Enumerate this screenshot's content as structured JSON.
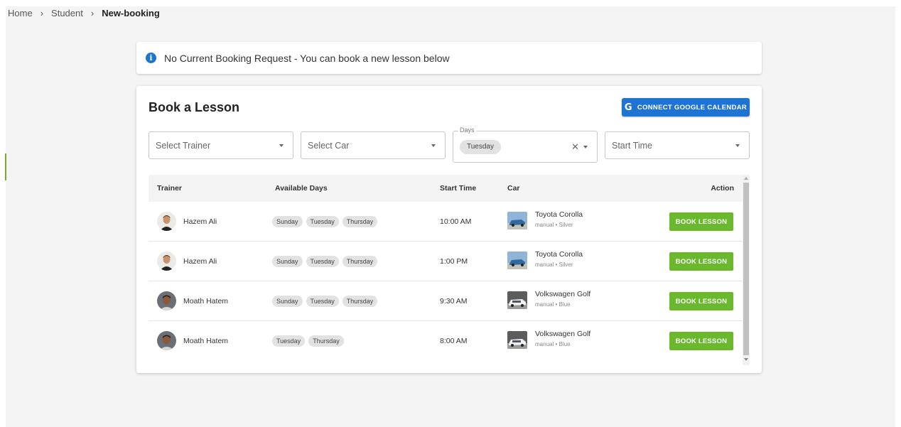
{
  "breadcrumb": {
    "items": [
      "Home",
      "Student",
      "New-booking"
    ],
    "separator": "›"
  },
  "alert": {
    "icon": "info-icon",
    "text": "No Current Booking Request - You can book a new lesson below"
  },
  "booking": {
    "title": "Book a Lesson",
    "gcal_button": {
      "icon": "google-g-icon",
      "glyph": "G",
      "label": "CONNECT GOOGLE CALENDAR"
    },
    "filters": {
      "trainer_placeholder": "Select Trainer",
      "car_placeholder": "Select Car",
      "days_legend": "Days",
      "days_selected": "Tuesday",
      "clear_glyph": "✕",
      "start_time_placeholder": "Start Time"
    },
    "table": {
      "headers": {
        "trainer": "Trainer",
        "days": "Available Days",
        "start": "Start Time",
        "car": "Car",
        "action": "Action"
      },
      "rows": [
        {
          "trainer": "Hazem Ali",
          "days": [
            "Sunday",
            "Tuesday",
            "Thursday"
          ],
          "start": "10:00 AM",
          "car": "Toyota Corolla",
          "car_sub": "manual • Silver",
          "action": "BOOK LESSON"
        },
        {
          "trainer": "Hazem Ali",
          "days": [
            "Sunday",
            "Tuesday",
            "Thursday"
          ],
          "start": "1:00 PM",
          "car": "Toyota Corolla",
          "car_sub": "manual • Silver",
          "action": "BOOK LESSON"
        },
        {
          "trainer": "Moath Hatem",
          "days": [
            "Sunday",
            "Tuesday",
            "Thursday"
          ],
          "start": "9:30 AM",
          "car": "Volkswagen Golf",
          "car_sub": "manual • Blue",
          "action": "BOOK LESSON"
        },
        {
          "trainer": "Moath Hatem",
          "days": [
            "Tuesday",
            "Thursday"
          ],
          "start": "8:00 AM",
          "car": "Volkswagen Golf",
          "car_sub": "manual • Blue",
          "action": "BOOK LESSON"
        }
      ]
    }
  },
  "colors": {
    "primary": "#1e74d2",
    "success": "#6ab82b",
    "info": "#1976d2"
  }
}
